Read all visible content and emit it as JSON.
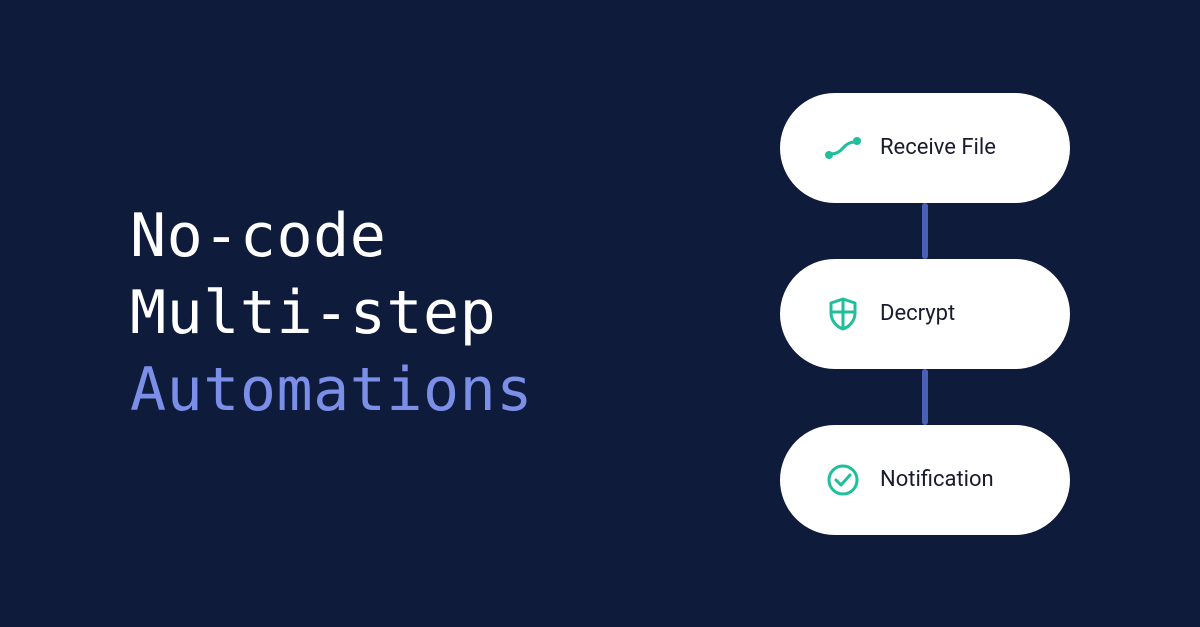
{
  "heading": {
    "line1": "No-code",
    "line2": "Multi-step",
    "line3": "Automations"
  },
  "steps": [
    {
      "label": "Receive File",
      "icon": "flow"
    },
    {
      "label": "Decrypt",
      "icon": "shield"
    },
    {
      "label": "Notification",
      "icon": "check-circle"
    }
  ],
  "colors": {
    "background": "#0f1b3a",
    "white": "#ffffff",
    "accent": "#7b8ee8",
    "teal": "#1fbf9c",
    "connector": "#4a5fb8"
  }
}
